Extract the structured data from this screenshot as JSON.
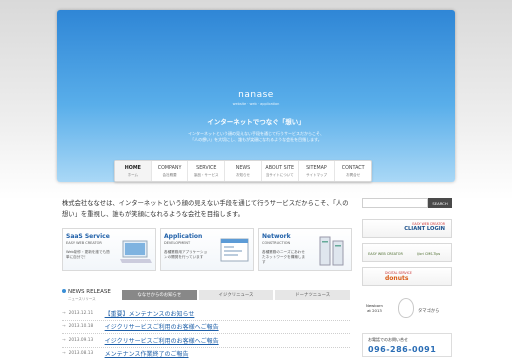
{
  "hero": {
    "logo": "nanase",
    "logo_sub": "website · web · application",
    "catch": "インターネットでつなぐ「想い」",
    "desc_line1": "インターネットという顔の見えない手段を通じて行うサービスだからこそ、",
    "desc_line2": "「人の想い」を大切にし、誰もが笑顔になれるような会社を目指します。"
  },
  "nav": [
    {
      "en": "HOME",
      "ja": "ホーム"
    },
    {
      "en": "COMPANY",
      "ja": "会社概要"
    },
    {
      "en": "SERVICE",
      "ja": "製品・サービス"
    },
    {
      "en": "NEWS",
      "ja": "お知らせ"
    },
    {
      "en": "ABOUT SITE",
      "ja": "当サイトについて"
    },
    {
      "en": "SITEMAP",
      "ja": "サイトマップ"
    },
    {
      "en": "CONTACT",
      "ja": "お問合せ"
    }
  ],
  "intro": {
    "line1": "株式会社ななせは、インターネットという顔の見えない手段を通じて行うサービスだからこそ、「人の",
    "line2": "想い」を重視し、誰もが笑顔になれるような会社を目指します。"
  },
  "services": [
    {
      "title": "SaaS Service",
      "sub": "EASY WEB CREATOR",
      "desc": "Web制作・更新を誰でも簡単に自分で！"
    },
    {
      "title": "Application",
      "sub": "DEVELOPMENT",
      "desc": "各種業務用アプリケーションの開発を行っています"
    },
    {
      "title": "Network",
      "sub": "CONSTRUCTION",
      "desc": "各種業務のニーズにあわせたネットワークを構築します"
    }
  ],
  "news": {
    "title": "NEWS RELEASE",
    "subtitle": "ニュースリリース",
    "tabs": [
      "ななせからのお知らせ",
      "イジクリニュース",
      "ドーナツニュース"
    ],
    "items": [
      {
        "date": "2013.12.11",
        "text": "【重要】メンテナンスのお知らせ"
      },
      {
        "date": "2013.10.18",
        "text": "イジクリサービスご利用のお客様へご報告"
      },
      {
        "date": "2013.09.13",
        "text": "イジクリサービスご利用のお客様へご報告"
      },
      {
        "date": "2013.08.13",
        "text": "メンテナンス作業終了のご報告"
      }
    ]
  },
  "sidebar": {
    "search_placeholder": "",
    "search_button": "SEARCH",
    "banner1_small": "EASY WEB CREATOR",
    "banner1_big": "CLIANT LOGIN",
    "banner2_left": "EASY WEB CREATOR",
    "banner2_right": "Ijicri CMS-Tips",
    "banner3_small": "DIGITAL SERVICE",
    "banner3_big": "donuts",
    "newborn_label": "Newborn",
    "newborn_year": "at 2013",
    "tamago": "タマゴから",
    "phone_label": "お電話でのお問い合せ",
    "phone_number": "096-286-0091"
  },
  "colors": {
    "hero_top": "#2f86d6",
    "hero_bottom": "#aad8f6",
    "link": "#1e5fa8",
    "accent_orange": "#d85a15"
  }
}
